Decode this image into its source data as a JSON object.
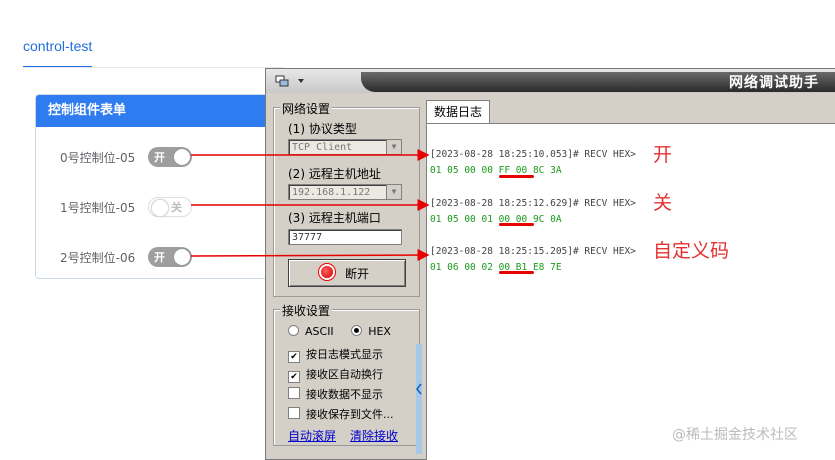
{
  "tab": {
    "label": "control-test"
  },
  "card": {
    "title": "控制组件表单",
    "rows": [
      {
        "label": "0号控制位-05",
        "state": "开",
        "on": true
      },
      {
        "label": "1号控制位-05",
        "state": "关",
        "on": false
      },
      {
        "label": "2号控制位-06",
        "state": "开",
        "on": true
      }
    ]
  },
  "window": {
    "title": "网络调试助手",
    "net": {
      "group_label": "网络设置",
      "protocol_label": "(1) 协议类型",
      "protocol_value": "TCP Client",
      "host_label": "(2) 远程主机地址",
      "host_value": "192.168.1.122",
      "port_label": "(3) 远程主机端口",
      "port_value": "37777",
      "disconnect_label": "断开"
    },
    "recv": {
      "group_label": "接收设置",
      "ascii_label": "ASCII",
      "hex_label": "HEX",
      "options": [
        {
          "label": "按日志模式显示",
          "checked": true
        },
        {
          "label": "接收区自动换行",
          "checked": true
        },
        {
          "label": "接收数据不显示",
          "checked": false
        },
        {
          "label": "接收保存到文件...",
          "checked": false
        }
      ],
      "auto_scroll": "自动滚屏",
      "clear_recv": "清除接收"
    },
    "log_tab": "数据日志",
    "log": [
      {
        "header": "[2023-08-28 18:25:10.053]# RECV HEX>",
        "hex": "01 05 00 00 FF 00 8C 3A",
        "note": "开"
      },
      {
        "header": "[2023-08-28 18:25:12.629]# RECV HEX>",
        "hex": "01 05 00 01 00 00 9C 0A",
        "note": "关"
      },
      {
        "header": "[2023-08-28 18:25:15.205]# RECV HEX>",
        "hex": "01 06 00 02 00 B1 E8 7E",
        "note": "自定义码"
      }
    ]
  },
  "watermark": "@稀土掘金技术社区",
  "colors": {
    "accent": "#2f7bf0",
    "annotation": "#e53030",
    "hex_text": "#1a9a1a"
  }
}
